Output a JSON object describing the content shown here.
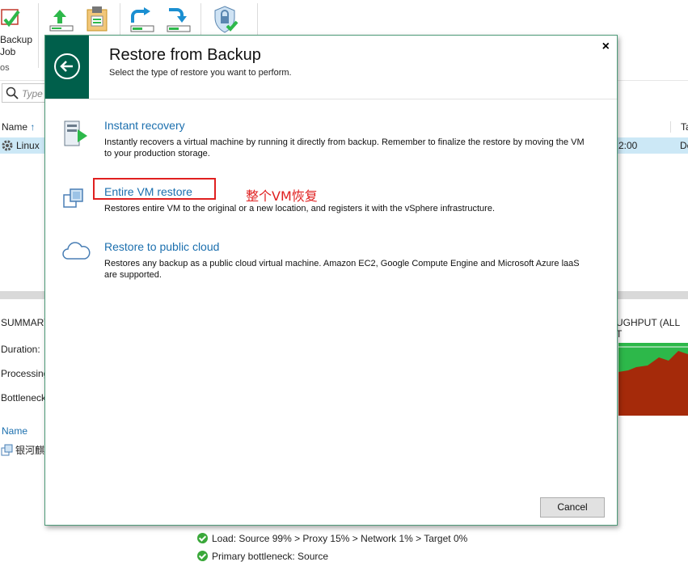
{
  "ribbon": {
    "backup_job_label_line1": "Backup",
    "backup_job_label_line2": "Job",
    "group_label": "os"
  },
  "search": {
    "placeholder": "Type"
  },
  "table": {
    "col_name": "Name",
    "col_type": "Ta",
    "rows": [
      {
        "name": "Linux",
        "time": "2:00",
        "type": "De"
      }
    ]
  },
  "summary": {
    "title": "SUMMARY",
    "duration_label": "Duration:",
    "processing_label": "Processing",
    "bottleneck_label": "Bottleneck",
    "throughput_title": "UGHPUT (ALL T",
    "vm_col_name": "Name",
    "vm_item": "银河麒"
  },
  "status": {
    "load_line": "Load: Source 99% > Proxy 15% > Network 1% > Target 0%",
    "bottleneck_line": "Primary bottleneck: Source"
  },
  "dialog": {
    "title": "Restore from Backup",
    "subtitle": "Select the type of restore you want to perform.",
    "close_label": "×",
    "options": [
      {
        "title": "Instant recovery",
        "description": "Instantly recovers a virtual machine by running it directly from backup. Remember to finalize the restore by moving the VM to your production storage.",
        "icon": "instant-recovery-icon"
      },
      {
        "title": "Entire VM restore",
        "description": "Restores entire VM to the original or a new location, and registers it with the vSphere infrastructure.",
        "icon": "entire-vm-icon"
      },
      {
        "title": "Restore to public cloud",
        "description": "Restores any backup as a public cloud virtual machine. Amazon EC2, Google Compute Engine and Microsoft Azure laaS are supported.",
        "icon": "cloud-icon"
      }
    ],
    "annotation": "整个VM恢复",
    "cancel_label": "Cancel"
  },
  "colors": {
    "accent": "#005f4b",
    "link": "#1b6fae",
    "annotation": "#e02020",
    "selected_row": "#cce8f6",
    "chart_red": "#a52a0a",
    "chart_green": "#2db84a"
  }
}
